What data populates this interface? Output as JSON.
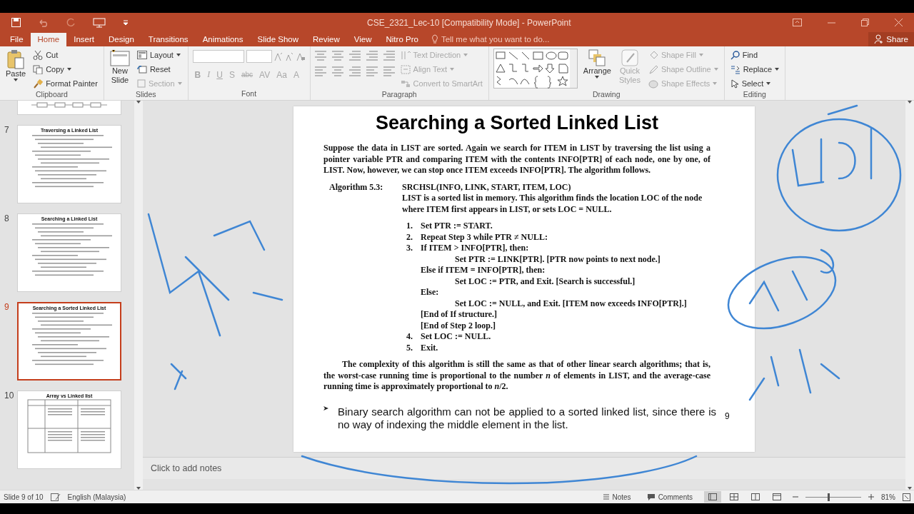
{
  "window": {
    "title": "CSE_2321_Lec-10 [Compatibility Mode] - PowerPoint"
  },
  "tabs": [
    {
      "label": "File",
      "selected": false
    },
    {
      "label": "Home",
      "selected": true
    },
    {
      "label": "Insert",
      "selected": false
    },
    {
      "label": "Design",
      "selected": false
    },
    {
      "label": "Transitions",
      "selected": false
    },
    {
      "label": "Animations",
      "selected": false
    },
    {
      "label": "Slide Show",
      "selected": false
    },
    {
      "label": "Review",
      "selected": false
    },
    {
      "label": "View",
      "selected": false
    },
    {
      "label": "Nitro Pro",
      "selected": false
    }
  ],
  "tell_me": {
    "placeholder": "Tell me what you want to do..."
  },
  "share": {
    "label": "Share"
  },
  "ribbon": {
    "clipboard": {
      "label": "Clipboard",
      "paste": "Paste",
      "cut": "Cut",
      "copy": "Copy",
      "format_painter": "Format Painter"
    },
    "slides": {
      "label": "Slides",
      "new_slide": "New Slide",
      "layout": "Layout",
      "reset": "Reset",
      "section": {
        "label": "Section",
        "disabled": true
      }
    },
    "font": {
      "label": "Font",
      "disabled": true,
      "buttons": [
        "B",
        "I",
        "U",
        "S",
        "abc",
        "AV",
        "Aa",
        "A"
      ]
    },
    "paragraph": {
      "label": "Paragraph",
      "text_direction": {
        "label": "Text Direction",
        "disabled": true
      },
      "align_text": {
        "label": "Align Text",
        "disabled": true
      },
      "convert_to_smartart": {
        "label": "Convert to SmartArt",
        "disabled": true
      }
    },
    "drawing": {
      "label": "Drawing",
      "arrange": "Arrange",
      "quick_styles": {
        "label": "Quick Styles",
        "disabled": true
      },
      "shape_fill": {
        "label": "Shape Fill",
        "disabled": true
      },
      "shape_outline": {
        "label": "Shape Outline",
        "disabled": true
      },
      "shape_effects": {
        "label": "Shape Effects",
        "disabled": true
      }
    },
    "editing": {
      "label": "Editing",
      "find": "Find",
      "replace": "Replace",
      "select": "Select"
    }
  },
  "thumbnails": [
    {
      "kind": "partial",
      "selected": false
    },
    {
      "kind": "text",
      "number": "7",
      "title": "Traversing a Linked List",
      "selected": false
    },
    {
      "kind": "text",
      "number": "8",
      "title": "Searching a Linked List",
      "selected": false
    },
    {
      "kind": "text",
      "number": "9",
      "title": "Searching a Sorted Linked List",
      "selected": true
    },
    {
      "kind": "table",
      "number": "10",
      "title": "Array vs Linked list",
      "selected": false
    }
  ],
  "slide": {
    "title": "Searching a Sorted Linked List",
    "intro": "Suppose the data in LIST are sorted. Again we search for ITEM in LIST by traversing the list using a pointer variable PTR and comparing ITEM with the contents INFO[PTR] of each node, one by one, of LIST. Now, however, we can stop once ITEM exceeds INFO[PTR]. The algorithm follows.",
    "algorithm": {
      "label": "Algorithm 5.3:",
      "header": "SRCHSL(INFO, LINK, START, ITEM, LOC)",
      "description": "LIST is a sorted list in memory. This algorithm finds the location LOC of the node where ITEM first appears in LIST, or sets LOC = NULL.",
      "steps": [
        {
          "number": "1.",
          "text": "Set PTR := START."
        },
        {
          "number": "2.",
          "text": "Repeat Step 3 while PTR ≠ NULL:"
        },
        {
          "number": "3.",
          "text": "If ITEM > INFO[PTR], then:",
          "children": [
            {
              "text": "Set PTR := LINK[PTR]. [PTR now points to next node.]"
            }
          ]
        },
        {
          "text": "Else if ITEM = INFO[PTR], then:",
          "children": [
            {
              "text": "Set LOC := PTR, and Exit. [Search is successful.]"
            }
          ]
        },
        {
          "text": "Else:",
          "children": [
            {
              "text": "Set LOC := NULL, and Exit. [ITEM now exceeds INFO[PTR].]"
            }
          ]
        },
        {
          "text": "[End of If structure.]"
        },
        {
          "text": "[End of Step 2 loop.]"
        },
        {
          "number": "4.",
          "text": "Set LOC := NULL."
        },
        {
          "number": "5.",
          "text": "Exit."
        }
      ]
    },
    "complexity": "The complexity of this algorithm is still the same as that of other linear search algorithms; that is, the worst-case running time is proportional to the number *n* of elements in LIST, and the average-case running time is approximately proportional to *n*/2.",
    "bullet": "Binary search algorithm can not be applied to a sorted linked list, since there is no way of indexing the middle element in the list.",
    "page_number": "9"
  },
  "notes": {
    "placeholder": "Click to add notes"
  },
  "status_bar": {
    "slide_info": "Slide 9 of 10",
    "language": "English (Malaysia)",
    "notes": "Notes",
    "comments": "Comments",
    "view_buttons": [
      {
        "selected": true
      },
      {
        "selected": false
      },
      {
        "selected": false
      },
      {
        "selected": false
      }
    ],
    "zoom_slider": {
      "level": 0.4
    },
    "zoom": "81%"
  }
}
